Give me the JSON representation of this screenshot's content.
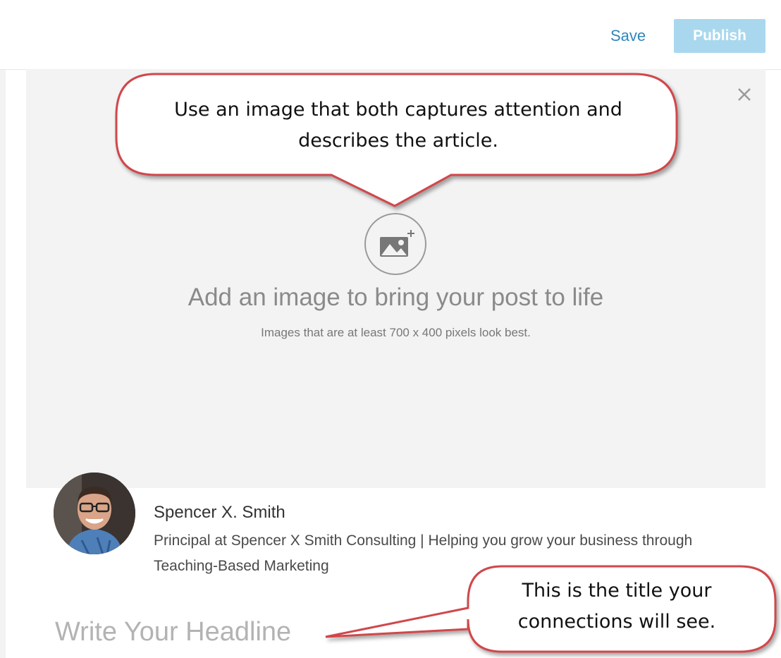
{
  "toolbar": {
    "save_label": "Save",
    "publish_label": "Publish"
  },
  "image_area": {
    "title": "Add an image to bring your post to life",
    "subtitle": "Images that are at least 700 x 400 pixels look best.",
    "upload_icon": "image-plus-icon",
    "close_icon": "close-icon"
  },
  "author": {
    "name": "Spencer X. Smith",
    "title": "Principal at Spencer X Smith Consulting | Helping you grow your business through Teaching-Based Marketing"
  },
  "headline": {
    "placeholder": "Write Your Headline"
  },
  "callouts": {
    "image_tip": "Use an image that both captures attention and describes the article.",
    "headline_tip": "This is the title your connections will see."
  },
  "colors": {
    "link": "#2f86bd",
    "publish_bg": "#a9d8ee",
    "callout_border": "#d0474c",
    "image_area_bg": "#f3f3f3"
  }
}
